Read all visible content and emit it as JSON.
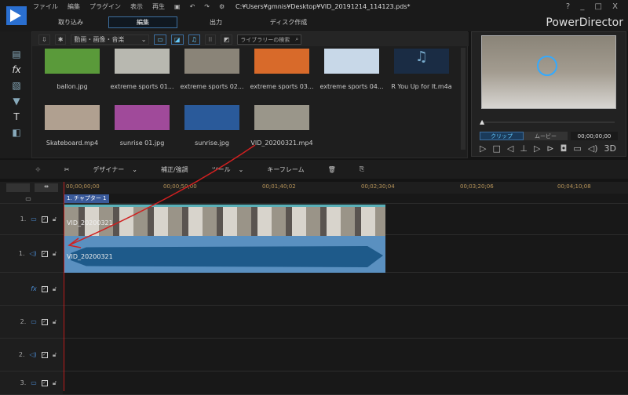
{
  "menu": [
    "ファイル",
    "編集",
    "プラグイン",
    "表示",
    "再生"
  ],
  "title": "C:¥Users¥gmnis¥Desktop¥VID_20191214_114123.pds*",
  "window_controls": "? _ □ X",
  "tabs": [
    "取り込み",
    "編集",
    "出力",
    "ディスク作成"
  ],
  "brand": "PowerDirector",
  "library": {
    "filter": "動画・画像・音楽",
    "search_placeholder": "ライブラリーの検索",
    "items": [
      {
        "label": "ballon.jpg",
        "color": "#5a9a3a"
      },
      {
        "label": "extreme sports 01...",
        "color": "#b8b8b0"
      },
      {
        "label": "extreme sports 02...",
        "color": "#8a8478"
      },
      {
        "label": "extreme sports 03...",
        "color": "#d86a2a"
      },
      {
        "label": "extreme sports 04...",
        "color": "#c8d8e8"
      },
      {
        "label": "R You Up for It.m4a",
        "color": "#1a2c44"
      },
      {
        "label": "Skateboard.mp4",
        "color": "#b0a090"
      },
      {
        "label": "sunrise 01.jpg",
        "color": "#a04a9a"
      },
      {
        "label": "sunrise.jpg",
        "color": "#2a5a9a"
      },
      {
        "label": "VID_20200321.mp4",
        "color": "#9a968a"
      }
    ]
  },
  "preview": {
    "clip": "クリップ",
    "movie": "ムービー",
    "timecode": "00;00;00;00",
    "btn_3d": "3D"
  },
  "edit_toolbar": {
    "designer": "デザイナー",
    "fix": "補正/強調",
    "tools": "ツール",
    "keyframe": "キーフレーム"
  },
  "ruler": [
    "00;00;00;00",
    "00;00;50;00",
    "00;01;40;02",
    "00;02;30;04",
    "00;03;20;06",
    "00;04;10;08"
  ],
  "chapter": "1. チャプター 1",
  "tracks": [
    {
      "num": "1.",
      "type": "video"
    },
    {
      "num": "1.",
      "type": "audio"
    },
    {
      "num": "",
      "type": "fx"
    },
    {
      "num": "2.",
      "type": "video"
    },
    {
      "num": "2.",
      "type": "audio"
    },
    {
      "num": "3.",
      "type": "video"
    }
  ],
  "clip": {
    "video_label": "VID_20200321",
    "audio_label": "VID_20200321"
  }
}
